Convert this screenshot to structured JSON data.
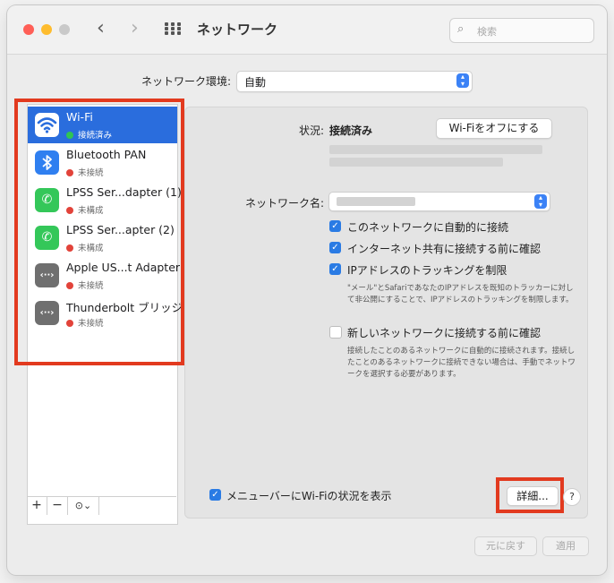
{
  "window": {
    "title": "ネットワーク",
    "search_placeholder": "検索"
  },
  "location": {
    "label": "ネットワーク環境:",
    "value": "自動"
  },
  "services": [
    {
      "name": "Wi-Fi",
      "status": "接続済み",
      "status_color": "#30c552",
      "icon": "wifi-icon",
      "icon_color": "#ffffff",
      "active": true
    },
    {
      "name": "Bluetooth PAN",
      "status": "未接続",
      "status_color": "#e2433a",
      "icon": "bluetooth-icon",
      "icon_color": "#2f7ff0",
      "active": false
    },
    {
      "name": "LPSS Ser...dapter (1)",
      "status": "未構成",
      "status_color": "#e2433a",
      "icon": "phone-icon",
      "icon_color": "#34c759",
      "active": false
    },
    {
      "name": "LPSS Ser...apter (2)",
      "status": "未構成",
      "status_color": "#e2433a",
      "icon": "phone-icon",
      "icon_color": "#34c759",
      "active": false
    },
    {
      "name": "Apple US...t Adapter",
      "status": "未接続",
      "status_color": "#e2433a",
      "icon": "ethernet-icon",
      "icon_color": "#6f6f6f",
      "active": false
    },
    {
      "name": "Thunderbolt ブリッジ",
      "status": "未接続",
      "status_color": "#e2433a",
      "icon": "ethernet-icon",
      "icon_color": "#6f6f6f",
      "active": false
    }
  ],
  "sidebar_controls": {
    "add": "+",
    "remove": "−",
    "more": "⊙⌄"
  },
  "detail": {
    "status_label": "状況:",
    "status_value": "接続済み",
    "wifi_off_button": "Wi-Fiをオフにする",
    "network_name_label": "ネットワーク名:",
    "options": [
      {
        "label": "このネットワークに自動的に接続",
        "checked": true
      },
      {
        "label": "インターネット共有に接続する前に確認",
        "checked": true
      },
      {
        "label": "IPアドレスのトラッキングを制限",
        "checked": true
      }
    ],
    "tracking_description": "\"メール\"とSafariであなたのIPアドレスを既知のトラッカーに対して非公開にすることで、IPアドレスのトラッキングを制限します。",
    "ask_new_label": "新しいネットワークに接続する前に確認",
    "ask_new_checked": false,
    "ask_new_description": "接続したことのあるネットワークに自動的に接続されます。接続したことのあるネットワークに接続できない場合は、手動でネットワークを選択する必要があります。",
    "menubar_label": "メニューバーにWi-Fiの状況を表示",
    "menubar_checked": true,
    "advanced_button": "詳細...",
    "help": "?"
  },
  "footer": {
    "revert": "元に戻す",
    "apply": "適用"
  },
  "colors": {
    "accent": "#2a6ddd",
    "highlight": "#e23a1f"
  }
}
